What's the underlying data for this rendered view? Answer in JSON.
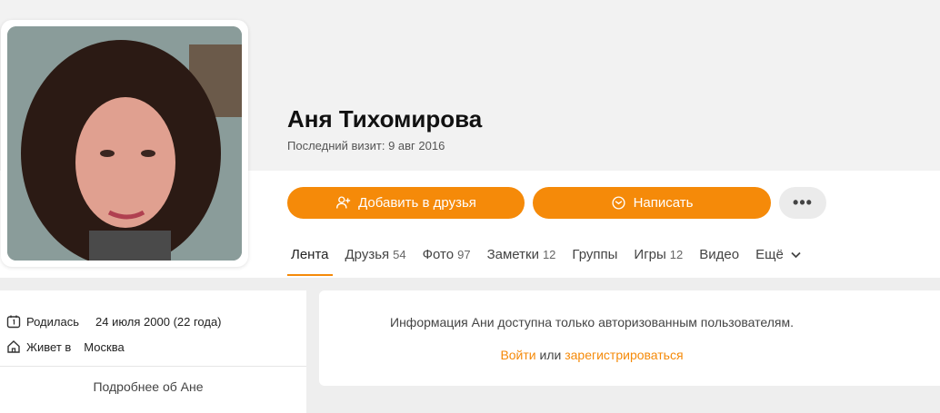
{
  "profile": {
    "name": "Аня Тихомирова",
    "last_visit": "Последний визит: 9 авг 2016"
  },
  "actions": {
    "add_friend_label": "Добавить в друзья",
    "add_friend_icon": "add-user-icon",
    "message_label": "Написать",
    "message_icon": "envelope-icon",
    "more_label": "•••"
  },
  "tabs": [
    {
      "label": "Лента",
      "count": ""
    },
    {
      "label": "Друзья",
      "count": "54"
    },
    {
      "label": "Фото",
      "count": "97"
    },
    {
      "label": "Заметки",
      "count": "12"
    },
    {
      "label": "Группы",
      "count": ""
    },
    {
      "label": "Игры",
      "count": "12"
    },
    {
      "label": "Видео",
      "count": ""
    },
    {
      "label": "Ещё",
      "count": ""
    }
  ],
  "about": {
    "born_label": "Родилась",
    "born_value": "24 июля 2000 (22 года)",
    "lives_label": "Живет в",
    "lives_value": "Москва",
    "more_link": "Подробнее об Ане"
  },
  "restricted": {
    "message": "Информация Ани доступна только авторизованным пользователям.",
    "login": "Войти",
    "or": "или",
    "register": "зарегистрироваться"
  },
  "colors": {
    "accent": "#f58a09",
    "background": "#eeeeee"
  }
}
